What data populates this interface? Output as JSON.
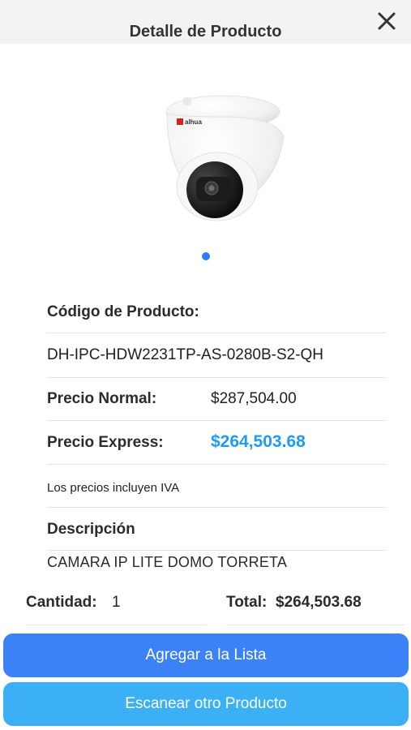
{
  "header": {
    "title": "Detalle de Producto",
    "close_icon": "close-icon"
  },
  "product": {
    "image_icon": "dome-camera-image",
    "brand_logo_text": "alhua",
    "carousel": {
      "current": 1,
      "total": 1
    },
    "code_label": "Código de Producto:",
    "code_value": "DH-IPC-HDW2231TP-AS-0280B-S2-QH",
    "normal_price_label": "Precio Normal:",
    "normal_price_value": "$287,504.00",
    "express_price_label": "Precio Express:",
    "express_price_value": "$264,503.68",
    "tax_note": "Los precios incluyen IVA",
    "description_label": "Descripción",
    "description_value": "CAMARA IP LITE DOMO TORRETA"
  },
  "footer": {
    "quantity_label": "Cantidad:",
    "quantity_value": "1",
    "total_label": "Total:",
    "total_value": "$264,503.68"
  },
  "actions": {
    "add_to_list_label": "Agregar a la Lista",
    "scan_other_label": "Escanear otro Producto"
  },
  "colors": {
    "primary_button": "#3b82f6",
    "secondary_button": "#3bb0f5",
    "express_price": "#1e9bf0",
    "carousel_dot": "#2b7cf6"
  }
}
